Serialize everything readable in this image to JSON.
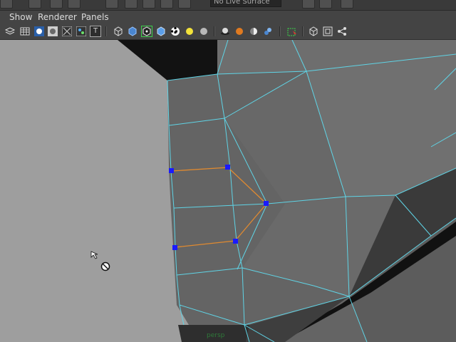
{
  "top_toolbar": {
    "live_surface_field": "No Live Surface"
  },
  "menu": {
    "items": [
      "Show",
      "Renderer",
      "Panels"
    ]
  },
  "panel_toolbar": {
    "icons": [
      "camera-attributes-icon",
      "grid-icon",
      "shaded-sphere-icon",
      "isolate-icon",
      "xray-icon",
      "image-plane-icon",
      "text-icon",
      "wireframe-cube-icon",
      "smooth-shade-cube-icon",
      "wireframe-on-shaded-icon",
      "textured-cube-icon",
      "checker-icon",
      "light-bulb-icon",
      "default-light-icon",
      "shadows-icon",
      "ambient-occlusion-icon",
      "motion-blur-icon",
      "multisample-icon",
      "select-camera-icon",
      "cube-icon",
      "resolution-gate-icon",
      "share-icon"
    ],
    "text_icon_label": "T"
  },
  "viewport": {
    "camera_label": "persp",
    "background_color": "#9e9e9e",
    "wire_color": "#5fd4e6",
    "selected_edge_color": "#e08a30",
    "vertex_color": "#1a1aff"
  }
}
